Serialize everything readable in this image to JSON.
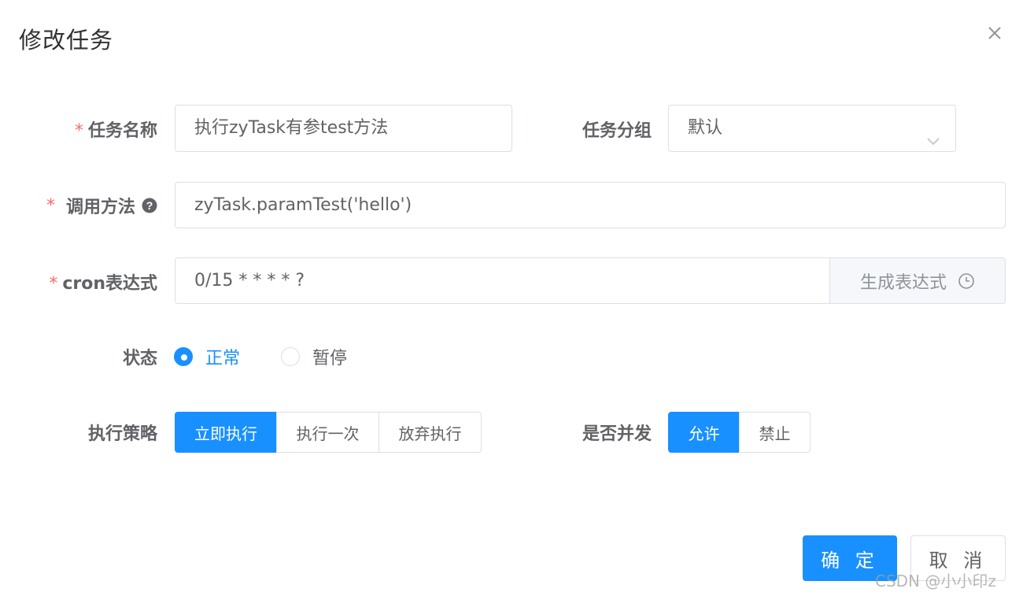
{
  "dialog": {
    "title": "修改任务",
    "close_icon": "close-icon"
  },
  "form": {
    "job_name": {
      "label": "任务名称",
      "required": "*",
      "value": "执行zyTask有参test方法"
    },
    "job_group": {
      "label": "任务分组",
      "value": "默认",
      "icon": "chevron-down-icon"
    },
    "invoke_target": {
      "label": "调用方法",
      "required": "*",
      "value": "zyTask.paramTest('hello')",
      "icon": "question-circle-icon"
    },
    "cron": {
      "label": "cron表达式",
      "required": "*",
      "value": "0/15 * * * * ?",
      "append_label": "生成表达式",
      "append_icon": "clock-icon"
    },
    "status": {
      "label": "状态",
      "options": [
        "正常",
        "暂停"
      ],
      "selected": "正常"
    },
    "misfire": {
      "label": "执行策略",
      "options": [
        "立即执行",
        "执行一次",
        "放弃执行"
      ],
      "selected": "立即执行"
    },
    "concurrent": {
      "label": "是否并发",
      "options": [
        "允许",
        "禁止"
      ],
      "selected": "允许"
    }
  },
  "footer": {
    "confirm_label": "确 定",
    "cancel_label": "取 消"
  },
  "watermark": "CSDN @小小印z",
  "colors": {
    "primary": "#1890ff",
    "required": "#f56c6c",
    "text": "#606266",
    "border": "#dcdfe6"
  }
}
